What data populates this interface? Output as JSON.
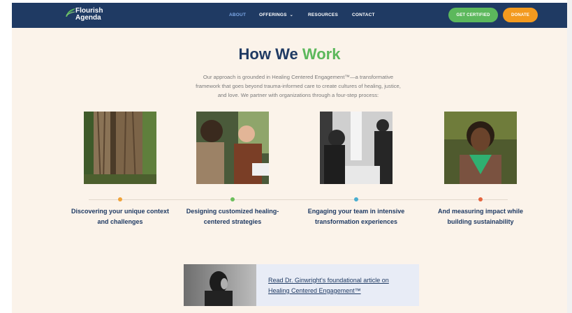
{
  "header": {
    "logo_line1": "Flourish",
    "logo_line2": "Agenda",
    "nav": [
      {
        "label": "ABOUT",
        "active": true
      },
      {
        "label": "OFFERINGS",
        "dropdown": true
      },
      {
        "label": "RESOURCES"
      },
      {
        "label": "CONTACT"
      }
    ],
    "cta_certified": "GET CERTIFIED",
    "cta_donate": "DONATE"
  },
  "hero": {
    "title_part1": "How We",
    "title_part2": "Work",
    "intro_line1": "Our approach is grounded in Healing Centered Engagement™—a transformative",
    "intro_line2": "framework that goes beyond trauma-informed care to create cultures of healing, justice,",
    "intro_line3": "and love. We partner with organizations through a four-step process:"
  },
  "steps": [
    {
      "line1": "Discovering your unique context",
      "line2": "and challenges",
      "dot_color": "#f0a33a"
    },
    {
      "line1": "Designing customized healing-",
      "line2": "centered strategies",
      "dot_color": "#6cbf5c"
    },
    {
      "line1": "Engaging your team in intensive",
      "line2": "transformation experiences",
      "dot_color": "#4aaed0"
    },
    {
      "line1": "And measuring impact while",
      "line2": "building sustainability",
      "dot_color": "#e5653f"
    }
  ],
  "article": {
    "link_line1": "Read Dr. Ginwright's foundational article on",
    "link_line2": "Healing Centered Engagement™"
  },
  "colors": {
    "navy": "#1f3a63",
    "green": "#5cb85c",
    "orange": "#f39a1f",
    "page_bg": "#fbf3ea"
  }
}
